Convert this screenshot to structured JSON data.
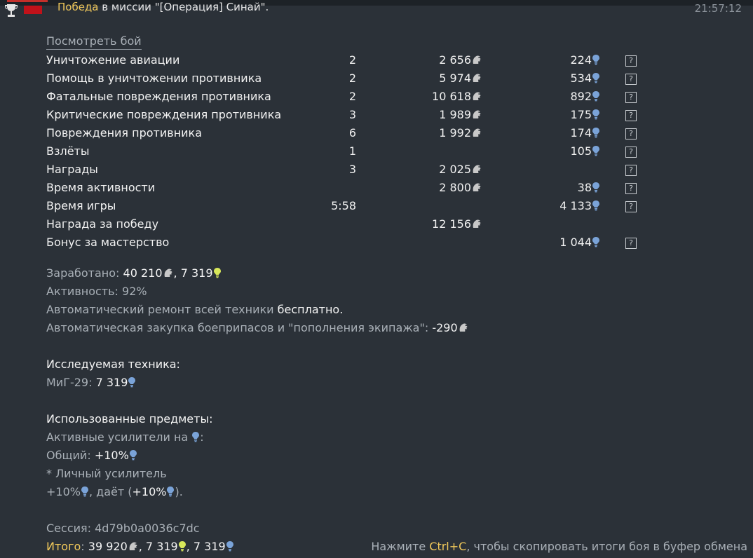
{
  "header": {
    "victory_word": "Победа",
    "title_rest": " в миссии \"[Операция] Синай\".",
    "time": "21:57:12"
  },
  "watch_battle": "Посмотреть бой",
  "rows": [
    {
      "name": "Уничтожение авиации",
      "count": "2",
      "lions": "2 656",
      "rp": "224",
      "help": "?"
    },
    {
      "name": "Помощь в уничтожении противника",
      "count": "2",
      "lions": "5 974",
      "rp": "534",
      "help": "?"
    },
    {
      "name": "Фатальные повреждения противника",
      "count": "2",
      "lions": "10 618",
      "rp": "892",
      "help": "?"
    },
    {
      "name": "Критические повреждения противника",
      "count": "3",
      "lions": "1 989",
      "rp": "175",
      "help": "?"
    },
    {
      "name": "Повреждения противника",
      "count": "6",
      "lions": "1 992",
      "rp": "174",
      "help": "?"
    },
    {
      "name": "Взлёты",
      "count": "1",
      "lions": "",
      "rp": "105",
      "help": "?"
    },
    {
      "name": "Награды",
      "count": "3",
      "lions": "2 025",
      "rp": "",
      "help": "?"
    },
    {
      "name": "Время активности",
      "count": "",
      "lions": "2 800",
      "rp": "38",
      "help": "?"
    },
    {
      "name": "Время игры",
      "count": "5:58",
      "lions": "",
      "rp": "4 133",
      "help": "?"
    },
    {
      "name": "Награда за победу",
      "count": "",
      "lions": "12 156",
      "rp": "",
      "help": ""
    },
    {
      "name": "Бонус за мастерство",
      "count": "",
      "lions": "",
      "rp": "1 044",
      "help": "?"
    }
  ],
  "summary": {
    "earned_label": "Заработано: ",
    "earned_lions": "40 210",
    "earned_sep": ", ",
    "earned_rp": "7 319",
    "activity_label": "Активность: 92%",
    "repair_label": "Автоматический ремонт всей техники ",
    "repair_value": "бесплатно.",
    "purchase_label": "Автоматическая закупка боеприпасов и \"пополнения экипажа\": ",
    "purchase_value": "-290"
  },
  "research": {
    "heading": "Исследуемая техника:",
    "vehicle_label": "МиГ-29: ",
    "vehicle_rp": "7 319"
  },
  "items": {
    "heading": "Использованные предметы:",
    "boosters_label": "Активные усилители на ",
    "boosters_colon": ":",
    "general_label": "Общий: ",
    "general_value": "+10%",
    "personal_label": "* Личный усилитель",
    "personal_value": "+10%",
    "gives_label": ", даёт (",
    "gives_value": "+10%",
    "gives_end": ")."
  },
  "session": {
    "label": "Сессия: 4d79b0a0036c7dc"
  },
  "total": {
    "label": "Итого",
    "colon": ": ",
    "lions": "39 920",
    "sep1": ", ",
    "rp1": "7 319",
    "sep2": ", ",
    "rp2": "7 319"
  },
  "hint": {
    "pre": "Нажмите ",
    "key": "Ctrl+C",
    "post": ", чтобы скопировать итоги боя в буфер обмена"
  },
  "colors": {
    "background": "#2b3138",
    "accent_yellow": "#f0c85a",
    "rp_icon_blue": "#7aa3d8",
    "lion_icon_gray": "#c8c8c8",
    "gold_icon_yellow": "#d8e85a"
  }
}
